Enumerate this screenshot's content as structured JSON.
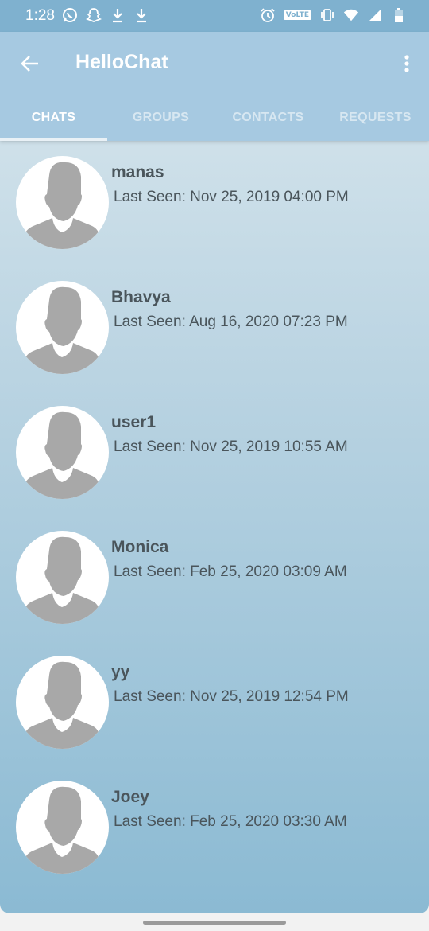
{
  "status_bar": {
    "time": "1:28",
    "left_icons": [
      "whatsapp-icon",
      "snapchat-icon",
      "download-icon",
      "download-icon"
    ],
    "right_icons": [
      "alarm-icon",
      "volte-badge",
      "vibrate-icon",
      "wifi-icon",
      "signal-icon",
      "battery-icon"
    ],
    "volte_label": "VoLTE"
  },
  "app_bar": {
    "title": "HelloChat",
    "back_icon": "arrow-left-icon",
    "menu_icon": "more-vertical-icon"
  },
  "tabs": [
    {
      "label": "CHATS",
      "active": true
    },
    {
      "label": "GROUPS",
      "active": false
    },
    {
      "label": "CONTACTS",
      "active": false
    },
    {
      "label": "REQUESTS",
      "active": false
    }
  ],
  "chats": [
    {
      "name": "manas",
      "last_seen": "Last Seen: Nov 25, 2019 04:00 PM"
    },
    {
      "name": "Bhavya",
      "last_seen": "Last Seen: Aug 16, 2020 07:23 PM"
    },
    {
      "name": "user1",
      "last_seen": "Last Seen: Nov 25, 2019 10:55 AM"
    },
    {
      "name": "Monica",
      "last_seen": "Last Seen: Feb 25, 2020 03:09 AM"
    },
    {
      "name": "yy",
      "last_seen": "Last Seen: Nov 25, 2019 12:54 PM"
    },
    {
      "name": "Joey",
      "last_seen": "Last Seen: Feb 25, 2020 03:30 AM"
    }
  ],
  "colors": {
    "app_bar": "#a6c9e1",
    "status_bar": "#7fb1cf",
    "text": "#4a555b",
    "avatar_silhouette": "#a8a8a8"
  }
}
